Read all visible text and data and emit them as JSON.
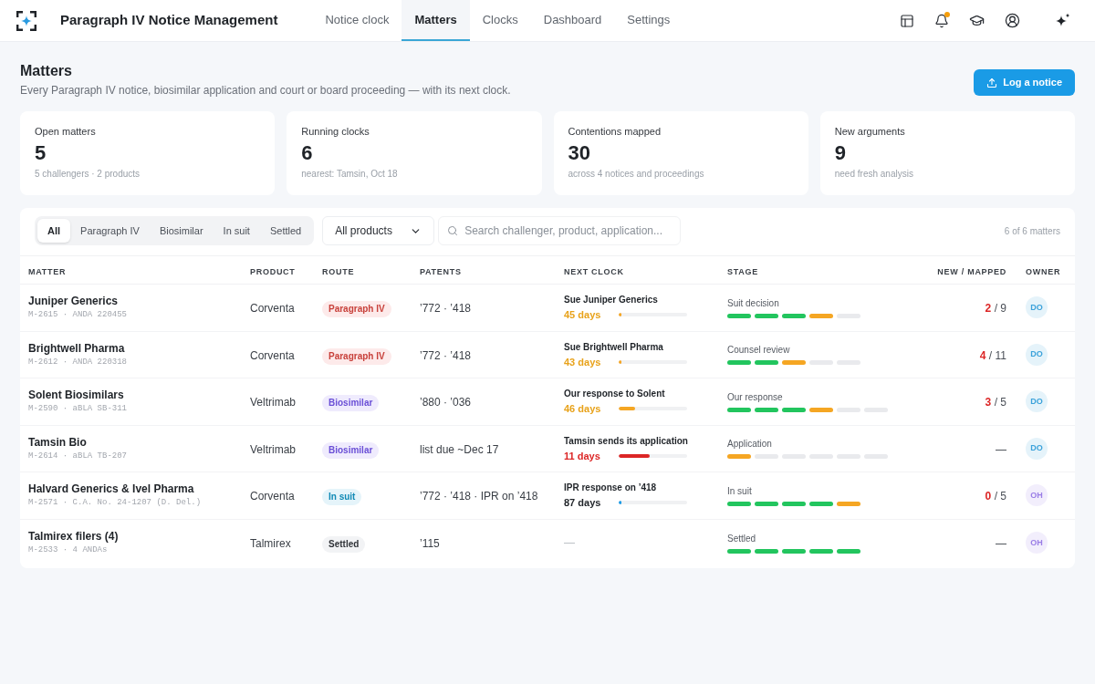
{
  "app": {
    "title": "Paragraph IV Notice Management"
  },
  "nav": [
    {
      "label": "Notice clock",
      "selected": false
    },
    {
      "label": "Matters",
      "selected": true
    },
    {
      "label": "Clocks",
      "selected": false
    },
    {
      "label": "Dashboard",
      "selected": false
    },
    {
      "label": "Settings",
      "selected": false
    }
  ],
  "notifications": {
    "unread": true
  },
  "page": {
    "title": "Matters",
    "subtitle": "Every Paragraph IV notice, biosimilar application and court or board proceeding — with its next clock.",
    "action": "Log a notice"
  },
  "stats": [
    {
      "label": "Open matters",
      "value": "5",
      "note": "5 challengers · 2 products"
    },
    {
      "label": "Running clocks",
      "value": "6",
      "note": "nearest: Tamsin, Oct 18"
    },
    {
      "label": "Contentions mapped",
      "value": "30",
      "note": "across 4 notices and proceedings"
    },
    {
      "label": "New arguments",
      "value": "9",
      "note": "need fresh analysis"
    }
  ],
  "filters": {
    "segments": [
      {
        "label": "All",
        "selected": true
      },
      {
        "label": "Paragraph IV",
        "selected": false
      },
      {
        "label": "Biosimilar",
        "selected": false
      },
      {
        "label": "In suit",
        "selected": false
      },
      {
        "label": "Settled",
        "selected": false
      }
    ],
    "product": {
      "value": "All products"
    },
    "search": {
      "placeholder": "Search challenger, product, application..."
    },
    "count": "6 of 6 matters"
  },
  "table": {
    "columns": [
      "MATTER",
      "PRODUCT",
      "ROUTE",
      "PATENTS",
      "NEXT CLOCK",
      "STAGE",
      "NEW / MAPPED",
      "OWNER"
    ],
    "rows": [
      {
        "matter": "Juniper Generics",
        "ref": "M-2615 · ANDA 220455",
        "product": "Corventa",
        "route": {
          "label": "Paragraph IV",
          "kind": "paragraph_iv"
        },
        "patents": "’772 · ’418",
        "next_clock": {
          "title": "Sue Juniper Generics",
          "days": "45 days",
          "kind": "warning",
          "level": 0.04
        },
        "stage": {
          "label": "Suit decision",
          "steps": [
            {
              "kind": "done"
            },
            {
              "kind": "done"
            },
            {
              "kind": "done"
            },
            {
              "kind": "current"
            },
            {
              "kind": "pending"
            }
          ]
        },
        "counts": {
          "new": "2",
          "separator": "/",
          "mapped": "9"
        },
        "owner": {
          "initials": "DO",
          "color": "#3ba2da"
        }
      },
      {
        "matter": "Brightwell Pharma",
        "ref": "M-2612 · ANDA 220318",
        "product": "Corventa",
        "route": {
          "label": "Paragraph IV",
          "kind": "paragraph_iv"
        },
        "patents": "’772 · ’418",
        "next_clock": {
          "title": "Sue Brightwell Pharma",
          "days": "43 days",
          "kind": "warning",
          "level": 0.04
        },
        "stage": {
          "label": "Counsel review",
          "steps": [
            {
              "kind": "done"
            },
            {
              "kind": "done"
            },
            {
              "kind": "current"
            },
            {
              "kind": "pending"
            },
            {
              "kind": "pending"
            }
          ]
        },
        "counts": {
          "new": "4",
          "separator": "/",
          "mapped": "11"
        },
        "owner": {
          "initials": "DO",
          "color": "#3ba2da"
        }
      },
      {
        "matter": "Solent Biosimilars",
        "ref": "M-2590 · aBLA SB-311",
        "product": "Veltrimab",
        "route": {
          "label": "Biosimilar",
          "kind": "biosimilar"
        },
        "patents": "’880 · ’036",
        "next_clock": {
          "title": "Our response to Solent",
          "days": "46 days",
          "kind": "warning",
          "level": 0.24
        },
        "stage": {
          "label": "Our response",
          "steps": [
            {
              "kind": "done"
            },
            {
              "kind": "done"
            },
            {
              "kind": "done"
            },
            {
              "kind": "current"
            },
            {
              "kind": "pending"
            },
            {
              "kind": "pending"
            }
          ]
        },
        "counts": {
          "new": "3",
          "separator": "/",
          "mapped": "5"
        },
        "owner": {
          "initials": "DO",
          "color": "#3ba2da"
        }
      },
      {
        "matter": "Tamsin Bio",
        "ref": "M-2614 · aBLA TB-207",
        "product": "Veltrimab",
        "route": {
          "label": "Biosimilar",
          "kind": "biosimilar"
        },
        "patents": "list due ~Dec 17",
        "next_clock": {
          "title": "Tamsin sends its application",
          "days": "11 days",
          "kind": "critical",
          "level": 0.45
        },
        "stage": {
          "label": "Application",
          "steps": [
            {
              "kind": "current"
            },
            {
              "kind": "pending"
            },
            {
              "kind": "pending"
            },
            {
              "kind": "pending"
            },
            {
              "kind": "pending"
            },
            {
              "kind": "pending"
            }
          ]
        },
        "counts": {
          "text": "—"
        },
        "owner": {
          "initials": "DO",
          "color": "#3ba2da"
        }
      },
      {
        "matter": "Halvard Generics & Ivel Pharma",
        "ref": "M-2571 · C.A. No. 24-1207 (D. Del.)",
        "product": "Corventa",
        "route": {
          "label": "In suit",
          "kind": "in_suit"
        },
        "patents": "’772 · ’418 · IPR on ’418",
        "next_clock": {
          "title": "IPR response on ’418",
          "days": "87 days",
          "kind": "normal",
          "level": 0.04
        },
        "stage": {
          "label": "In suit",
          "steps": [
            {
              "kind": "done"
            },
            {
              "kind": "done"
            },
            {
              "kind": "done"
            },
            {
              "kind": "done"
            },
            {
              "kind": "current"
            }
          ]
        },
        "counts": {
          "new": "0",
          "separator": "/",
          "mapped": "5"
        },
        "owner": {
          "initials": "OH",
          "color": "#9a7ee6"
        }
      },
      {
        "matter": "Talmirex filers (4)",
        "ref": "M-2533 · 4 ANDAs",
        "product": "Talmirex",
        "route": {
          "label": "Settled",
          "kind": "settled"
        },
        "patents": "’115",
        "next_clock": {
          "text": "—"
        },
        "stage": {
          "label": "Settled",
          "steps": [
            {
              "kind": "done"
            },
            {
              "kind": "done"
            },
            {
              "kind": "done"
            },
            {
              "kind": "done"
            },
            {
              "kind": "done"
            }
          ]
        },
        "counts": {
          "text": "—"
        },
        "owner": {
          "initials": "OH",
          "color": "#9a7ee6"
        }
      }
    ]
  }
}
